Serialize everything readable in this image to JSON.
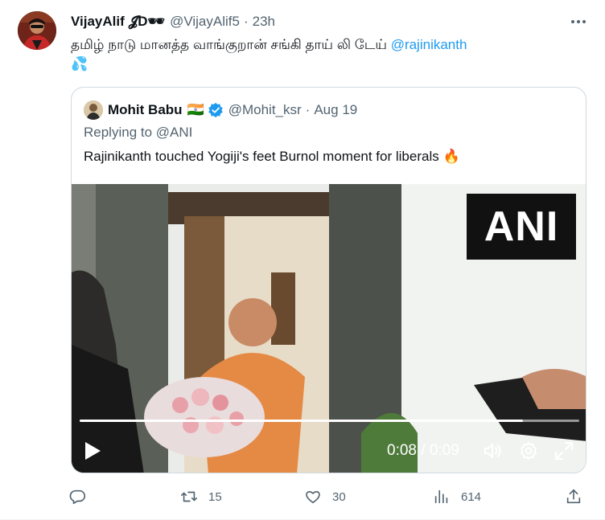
{
  "author": {
    "name": "VijayAlif",
    "name_suffix": " 𝓙D🕶",
    "handle": "@VijayAlif5",
    "separator": "·",
    "time": "23h"
  },
  "tweet": {
    "text": "தமிழ் நாடு மானத்த வாங்குறான் சங்கி தாய் லி டேய் ",
    "mention": "@rajinikanth",
    "emoji": "💦"
  },
  "quote": {
    "name": "Mohit Babu",
    "flag": "🇮🇳",
    "handle": "@Mohit_ksr",
    "separator": "·",
    "date": "Aug 19",
    "replying": "Replying to @ANI",
    "text": "Rajinikanth touched Yogiji's feet Burnol moment for liberals 🔥"
  },
  "video": {
    "watermark": "ANI",
    "time_display": "0:08 / 0:09",
    "progress": 0.888
  },
  "actions": {
    "reply_count": "",
    "retweet_count": "15",
    "like_count": "30",
    "view_count": "614"
  },
  "icons": {
    "more": "more-icon",
    "verified": "verified-badge-icon",
    "reply": "reply-icon",
    "retweet": "retweet-icon",
    "like": "like-icon",
    "views": "views-icon",
    "share": "share-icon",
    "play": "play-icon",
    "volume": "volume-icon",
    "settings": "settings-icon",
    "fullscreen": "fullscreen-icon"
  },
  "colors": {
    "link": "#1d9bf0",
    "muted": "#536471",
    "verified": "#1d9bf0"
  }
}
